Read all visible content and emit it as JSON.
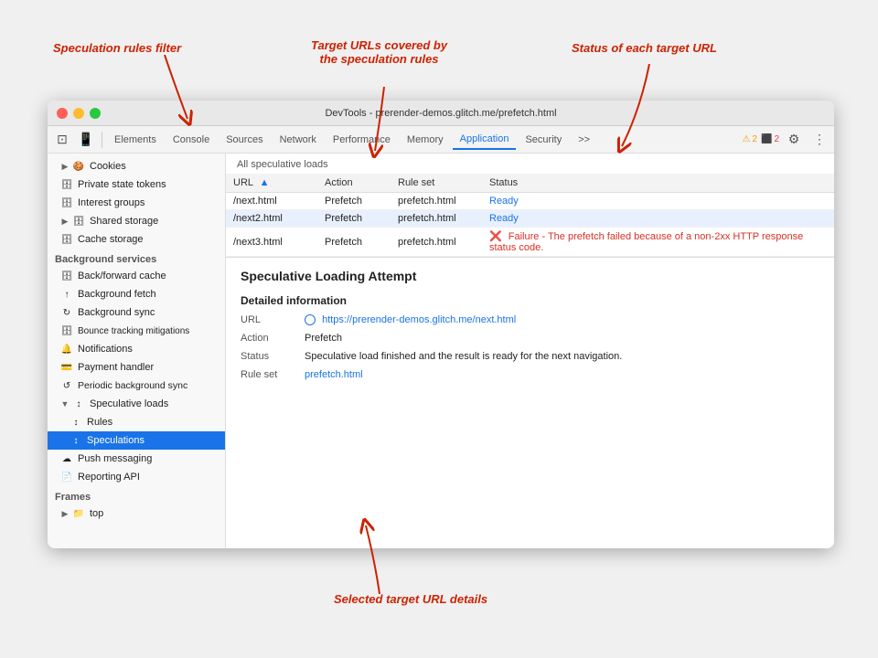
{
  "annotations": {
    "speculation_rules_filter": "Speculation rules filter",
    "target_urls_covered": "Target URLs covered by\nthe speculation rules",
    "status_of_each": "Status of each target URL",
    "selected_target_url_details": "Selected target URL details"
  },
  "window": {
    "title": "DevTools - prerender-demos.glitch.me/prefetch.html"
  },
  "toolbar": {
    "tabs": [
      "Elements",
      "Console",
      "Sources",
      "Network",
      "Performance",
      "Memory",
      "Application",
      "Security",
      ">>"
    ],
    "active_tab": "Application",
    "badges": {
      "warn": "2",
      "error": "2"
    }
  },
  "sidebar": {
    "sections": [
      {
        "items": [
          {
            "label": "Cookies",
            "icon": "▶",
            "indent": 0,
            "has_arrow": true
          },
          {
            "label": "Private state tokens",
            "icon": "🗄",
            "indent": 0
          },
          {
            "label": "Interest groups",
            "icon": "🗄",
            "indent": 0
          },
          {
            "label": "Shared storage",
            "icon": "▶",
            "indent": 0,
            "has_arrow": true
          },
          {
            "label": "Cache storage",
            "icon": "🗄",
            "indent": 0
          }
        ]
      },
      {
        "header": "Background services",
        "items": [
          {
            "label": "Back/forward cache",
            "icon": "🗄",
            "indent": 0
          },
          {
            "label": "Background fetch",
            "icon": "↑",
            "indent": 0
          },
          {
            "label": "Background sync",
            "icon": "↻",
            "indent": 0
          },
          {
            "label": "Bounce tracking mitigations",
            "icon": "🗄",
            "indent": 0
          },
          {
            "label": "Notifications",
            "icon": "🔔",
            "indent": 0
          },
          {
            "label": "Payment handler",
            "icon": "💳",
            "indent": 0
          },
          {
            "label": "Periodic background sync",
            "icon": "↺",
            "indent": 0
          },
          {
            "label": "Speculative loads",
            "icon": "▼",
            "indent": 0,
            "has_arrow": true
          },
          {
            "label": "Rules",
            "icon": "↑↓",
            "indent": 1
          },
          {
            "label": "Speculations",
            "icon": "↑↓",
            "indent": 1,
            "selected": true
          },
          {
            "label": "Push messaging",
            "icon": "☁",
            "indent": 0
          },
          {
            "label": "Reporting API",
            "icon": "📄",
            "indent": 0
          }
        ]
      },
      {
        "header": "Frames",
        "items": [
          {
            "label": "top",
            "icon": "▶",
            "indent": 0,
            "has_arrow": true,
            "folder_icon": "📁"
          }
        ]
      }
    ]
  },
  "main": {
    "all_speculative_loads_label": "All speculative loads",
    "table": {
      "headers": [
        "URL",
        "Action",
        "Rule set",
        "Status"
      ],
      "rows": [
        {
          "url": "/next.html",
          "action": "Prefetch",
          "rule_set": "prefetch.html",
          "status": "Ready",
          "status_type": "ready"
        },
        {
          "url": "/next2.html",
          "action": "Prefetch",
          "rule_set": "prefetch.html",
          "status": "Ready",
          "status_type": "ready",
          "selected": true
        },
        {
          "url": "/next3.html",
          "action": "Prefetch",
          "rule_set": "prefetch.html",
          "status": "Failure - The prefetch failed because of a non-2xx HTTP response status code.",
          "status_type": "error"
        }
      ]
    },
    "detail": {
      "title": "Speculative Loading Attempt",
      "section_title": "Detailed information",
      "fields": [
        {
          "label": "URL",
          "value": "https://prerender-demos.glitch.me/next.html",
          "type": "link"
        },
        {
          "label": "Action",
          "value": "Prefetch",
          "type": "text"
        },
        {
          "label": "Status",
          "value": "Speculative load finished and the result is ready for the next navigation.",
          "type": "text"
        },
        {
          "label": "Rule set",
          "value": "prefetch.html",
          "type": "link"
        }
      ]
    }
  }
}
